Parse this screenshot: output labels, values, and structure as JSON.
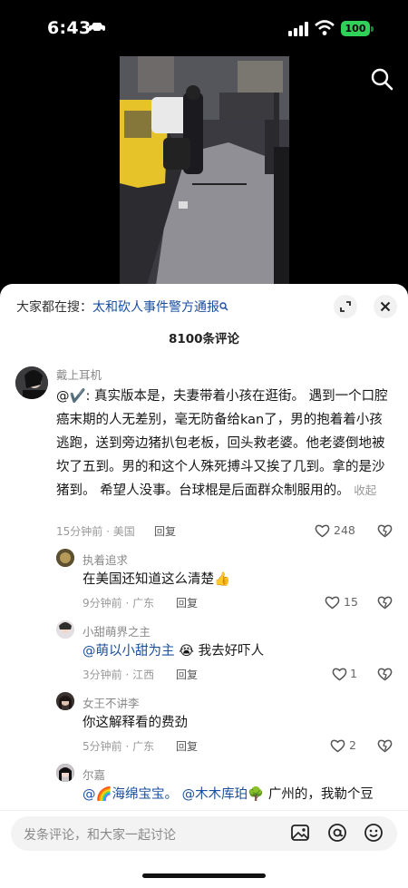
{
  "status": {
    "time": "6:43",
    "battery": "100"
  },
  "trending": {
    "prefix": "大家都在搜：",
    "query": "太和砍人事件警方通报"
  },
  "comments_count": "8100条评论",
  "comments": [
    {
      "user": "戴上耳机",
      "text_prefix": "@✔️: 真实版本是，夫妻带着小孩在逛街。 遇到一个口腔癌末期的人无差别，毫无防备给kan了，男的抱着着小孩逃跑，送到旁边猪扒包老板，回头救老婆。他老婆倒地被坎了五到。男的和这个人殊死搏斗又挨了几到。拿的是沙猪到。 希望人没事。台球棍是后面群众制服用的。",
      "fold": "收起",
      "meta": "15分钟前 · 美国",
      "reply": "回复",
      "likes": "248"
    },
    {
      "user": "执着追求",
      "text": "在美国还知道这么清楚👍",
      "meta": "9分钟前 · 广东",
      "reply": "回复",
      "likes": "15"
    },
    {
      "user": "小甜萌界之主",
      "mention": "@萌以小甜为主",
      "text": " 😭 我去好吓人",
      "meta": "3分钟前 · 江西",
      "reply": "回复",
      "likes": "1"
    },
    {
      "user": "女王不讲李",
      "text": "你这解释看的费劲",
      "meta": "5分钟前 · 广东",
      "reply": "回复",
      "likes": "2"
    },
    {
      "user": "尔嘉",
      "mention1": "@🌈海绵宝宝。",
      "mention2": "@木木库珀🌳",
      "text": " 广州的，我勒个豆"
    }
  ],
  "input": {
    "placeholder": "发条评论，和大家一起讨论"
  },
  "icons": [
    "car-icon",
    "signal-icon",
    "wifi-icon",
    "search-icon",
    "expand-icon",
    "close-icon",
    "heart-icon",
    "dislike-icon",
    "image-icon",
    "at-icon",
    "emoji-icon"
  ]
}
